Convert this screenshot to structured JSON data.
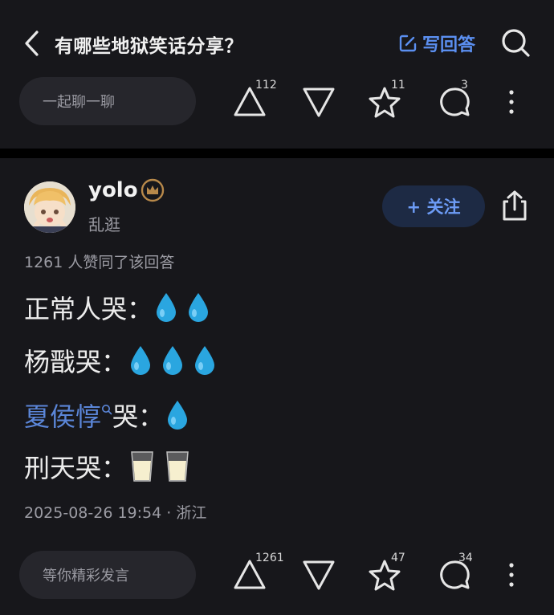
{
  "header": {
    "title": "有哪些地狱笑话分享？",
    "write_label": "写回答"
  },
  "top_actions": {
    "comment_placeholder": "一起聊一聊",
    "upvote_count": "112",
    "star_count": "11",
    "comment_count": "3"
  },
  "answer": {
    "username": "yolo",
    "user_subtitle": "乱逛",
    "follow_label": "+ 关注",
    "agree_text": "1261 人赞同了该回答",
    "lines": [
      {
        "text": "正常人哭：",
        "icon": "water-drop",
        "count": 2
      },
      {
        "text": "杨戬哭：",
        "icon": "water-drop",
        "count": 3
      },
      {
        "link_text": "夏侯惇",
        "text": "哭：",
        "icon": "water-drop",
        "count": 1
      },
      {
        "text": "刑天哭：",
        "icon": "milk-glass",
        "count": 2
      }
    ],
    "timestamp": "2025-08-26 19:54 · 浙江"
  },
  "bottom_actions": {
    "comment_placeholder": "等你精彩发言",
    "upvote_count": "1261",
    "star_count": "47",
    "comment_count": "34"
  },
  "colors": {
    "accent": "#5b8ff0",
    "link": "#5b86d8",
    "water": "#2aa6e0"
  }
}
